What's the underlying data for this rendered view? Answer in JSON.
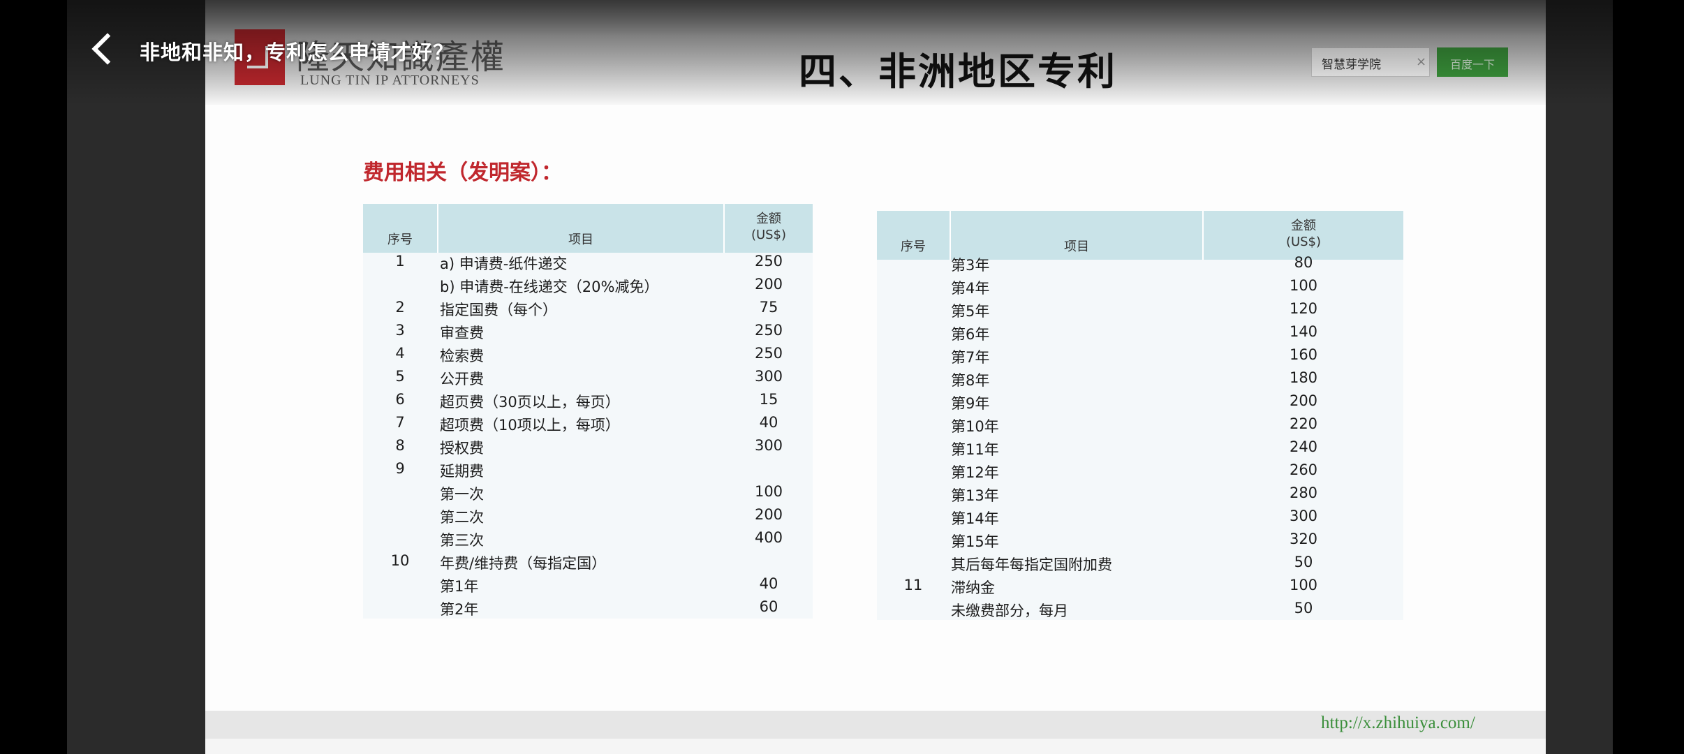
{
  "video": {
    "title": "非地和非知，专利怎么申请才好？"
  },
  "slide": {
    "logo_cn": "隆天知識產權",
    "logo_en": "LUNG TIN IP ATTORNEYS",
    "title": "四、非洲地区专利",
    "search": {
      "value": "智慧芽学院",
      "clear": "×",
      "button": "百度一下"
    },
    "section_heading": "费用相关（发明案）：",
    "footer_url": "http://x.zhihuiya.com/",
    "colors": {
      "accent_red": "#c0272d",
      "header_teal": "#c9e3e8",
      "url_green": "#3a8e3a"
    }
  },
  "table_left": {
    "headers": {
      "no": "序号",
      "item": "项目",
      "amount_line1": "金额",
      "amount_line2": "(US$)"
    },
    "rows": [
      {
        "no": "1",
        "item": "a) 申请费-纸件递交",
        "amount": "250"
      },
      {
        "no": "",
        "item": "b) 申请费-在线递交（20%减免）",
        "amount": "200"
      },
      {
        "no": "2",
        "item": "指定国费（每个）",
        "amount": "75"
      },
      {
        "no": "3",
        "item": "审查费",
        "amount": "250"
      },
      {
        "no": "4",
        "item": "检索费",
        "amount": "250"
      },
      {
        "no": "5",
        "item": "公开费",
        "amount": "300"
      },
      {
        "no": "6",
        "item": "超页费（30页以上，每页）",
        "amount": "15"
      },
      {
        "no": "7",
        "item": "超项费（10项以上，每项）",
        "amount": "40"
      },
      {
        "no": "8",
        "item": "授权费",
        "amount": "300"
      },
      {
        "no": "9",
        "item": "延期费",
        "amount": ""
      },
      {
        "no": "",
        "item": "第一次",
        "amount": "100"
      },
      {
        "no": "",
        "item": "第二次",
        "amount": "200"
      },
      {
        "no": "",
        "item": "第三次",
        "amount": "400"
      },
      {
        "no": "10",
        "item": "年费/维持费（每指定国）",
        "amount": ""
      },
      {
        "no": "",
        "item": "第1年",
        "amount": "40"
      },
      {
        "no": "",
        "item": "第2年",
        "amount": "60"
      }
    ]
  },
  "table_right": {
    "headers": {
      "no": "序号",
      "item": "项目",
      "amount_line1": "金额",
      "amount_line2": "(US$)"
    },
    "rows": [
      {
        "no": "",
        "item": "第3年",
        "amount": "80"
      },
      {
        "no": "",
        "item": "第4年",
        "amount": "100"
      },
      {
        "no": "",
        "item": "第5年",
        "amount": "120"
      },
      {
        "no": "",
        "item": "第6年",
        "amount": "140"
      },
      {
        "no": "",
        "item": "第7年",
        "amount": "160"
      },
      {
        "no": "",
        "item": "第8年",
        "amount": "180"
      },
      {
        "no": "",
        "item": "第9年",
        "amount": "200"
      },
      {
        "no": "",
        "item": "第10年",
        "amount": "220"
      },
      {
        "no": "",
        "item": "第11年",
        "amount": "240"
      },
      {
        "no": "",
        "item": "第12年",
        "amount": "260"
      },
      {
        "no": "",
        "item": "第13年",
        "amount": "280"
      },
      {
        "no": "",
        "item": "第14年",
        "amount": "300"
      },
      {
        "no": "",
        "item": "第15年",
        "amount": "320"
      },
      {
        "no": "",
        "item": "其后每年每指定国附加费",
        "amount": "50"
      },
      {
        "no": "11",
        "item": "滞纳金",
        "amount": "100"
      },
      {
        "no": "",
        "item": "未缴费部分，每月",
        "amount": "50"
      }
    ]
  }
}
